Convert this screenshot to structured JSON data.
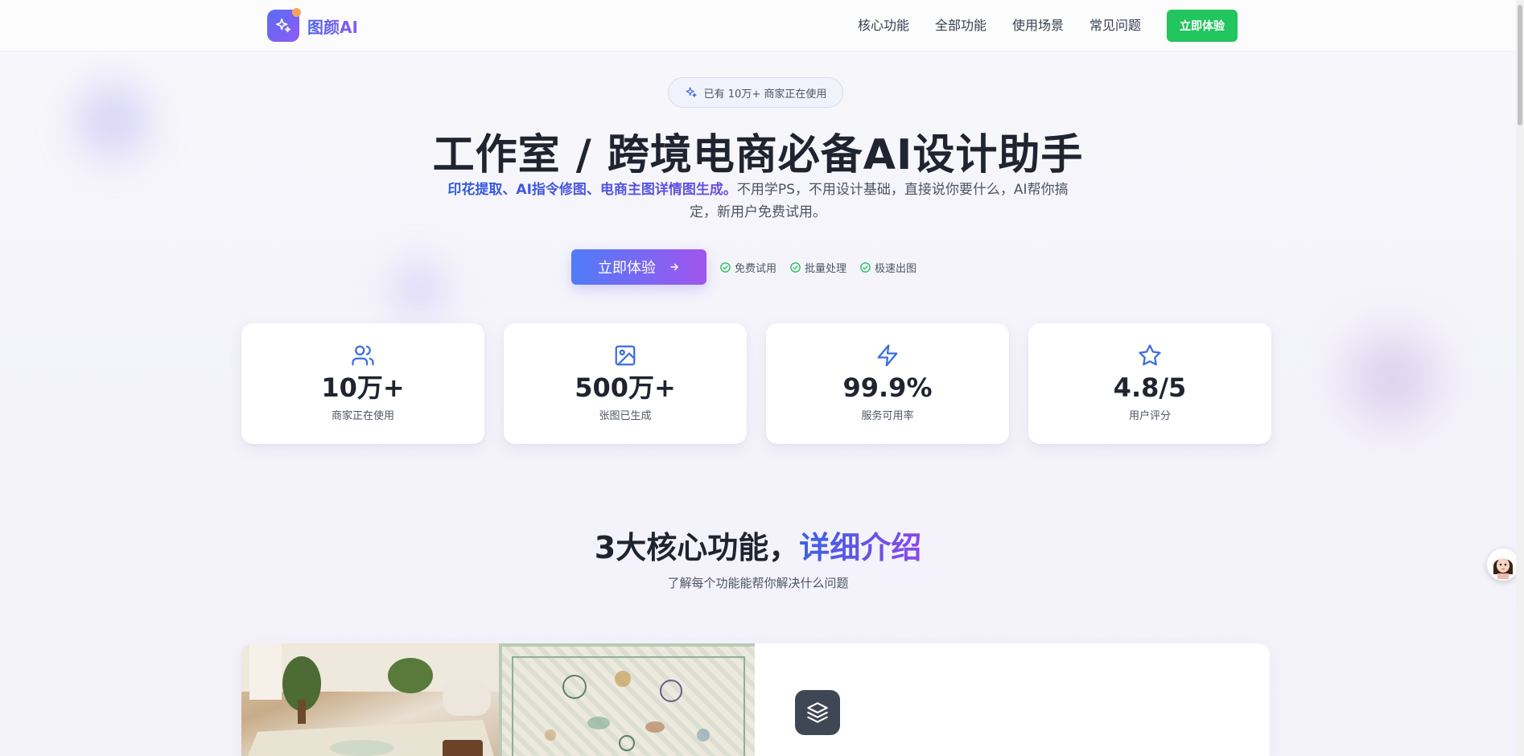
{
  "brand": {
    "name": "图颜AI",
    "logo_icon": "sparkle-icon"
  },
  "nav": {
    "items": [
      "核心功能",
      "全部功能",
      "使用场景",
      "常见问题"
    ],
    "cta": "立即体验"
  },
  "hero": {
    "pill": "已有 10万+ 商家正在使用",
    "title": "工作室 / 跨境电商必备AI设计助手",
    "subtitle_highlight": "印花提取、AI指令修图、电商主图详情图生成。",
    "subtitle_rest": "不用学PS，不用设计基础，直接说你要什么，AI帮你搞定，新用户免费试用。",
    "cta": "立即体验",
    "checks": [
      "免费试用",
      "批量处理",
      "极速出图"
    ]
  },
  "stats": [
    {
      "icon": "users-icon",
      "value": "10万+",
      "label": "商家正在使用"
    },
    {
      "icon": "image-icon",
      "value": "500万+",
      "label": "张图已生成"
    },
    {
      "icon": "lightning-icon",
      "value": "99.9%",
      "label": "服务可用率"
    },
    {
      "icon": "star-icon",
      "value": "4.8/5",
      "label": "用户评分"
    }
  ],
  "section": {
    "title_plain": "3大核心功能，",
    "title_accent": "详细介绍",
    "subtitle": "了解每个功能能帮你解决什么问题"
  },
  "feature": {
    "icon": "layers-icon"
  },
  "colors": {
    "primary_gradient_start": "#4f7cf7",
    "primary_gradient_end": "#a155ee",
    "nav_cta": "#22c55e",
    "stat_icon": "#3b6de0",
    "check": "#22c55e"
  }
}
